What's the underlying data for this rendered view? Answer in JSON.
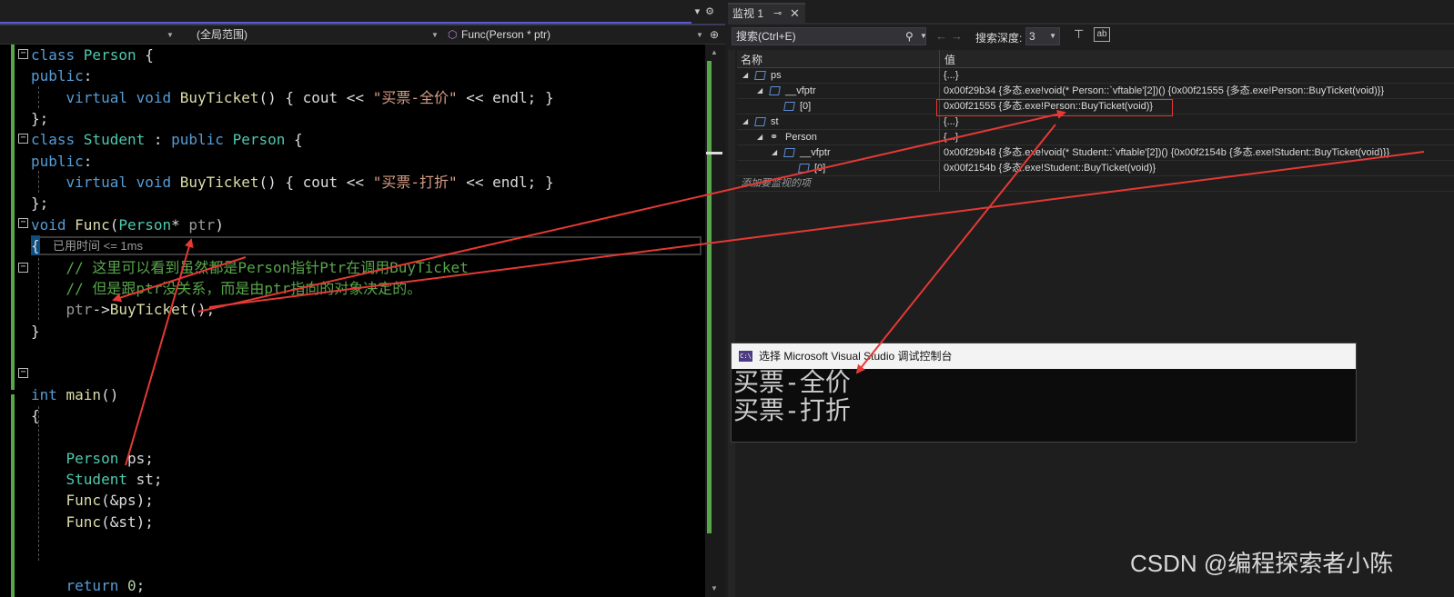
{
  "editor": {
    "nav": {
      "scope": "(全局范围)",
      "function": "Func(Person * ptr)"
    },
    "code_lines": [
      {
        "parts": [
          [
            "kw",
            "class "
          ],
          [
            "ty",
            "Person"
          ],
          [
            "pl",
            " {"
          ]
        ]
      },
      {
        "parts": [
          [
            "kw",
            "public"
          ],
          [
            "pl",
            ":"
          ]
        ]
      },
      {
        "parts": [
          [
            "pl",
            "    "
          ],
          [
            "kw",
            "virtual void "
          ],
          [
            "fn",
            "BuyTicket"
          ],
          [
            "pl",
            "() { cout << "
          ],
          [
            "str",
            "\"买票-全价\""
          ],
          [
            "pl",
            " << endl; }"
          ]
        ]
      },
      {
        "parts": [
          [
            "pl",
            "};"
          ]
        ]
      },
      {
        "parts": [
          [
            "kw",
            "class "
          ],
          [
            "ty",
            "Student"
          ],
          [
            "pl",
            " : "
          ],
          [
            "kw",
            "public "
          ],
          [
            "ty",
            "Person"
          ],
          [
            "pl",
            " {"
          ]
        ]
      },
      {
        "parts": [
          [
            "kw",
            "public"
          ],
          [
            "pl",
            ":"
          ]
        ]
      },
      {
        "parts": [
          [
            "pl",
            "    "
          ],
          [
            "kw",
            "virtual void "
          ],
          [
            "fn",
            "BuyTicket"
          ],
          [
            "pl",
            "() { cout << "
          ],
          [
            "str",
            "\"买票-打折\""
          ],
          [
            "pl",
            " << endl; }"
          ]
        ]
      },
      {
        "parts": [
          [
            "pl",
            "};"
          ]
        ]
      },
      {
        "parts": [
          [
            "kw",
            "void "
          ],
          [
            "fn",
            "Func"
          ],
          [
            "pl",
            "("
          ],
          [
            "ty",
            "Person"
          ],
          [
            "pl",
            "* "
          ],
          [
            "prm",
            "ptr"
          ],
          [
            "pl",
            ")"
          ]
        ]
      },
      {
        "parts": [
          [
            "pl",
            ""
          ]
        ]
      },
      {
        "parts": [
          [
            "pl",
            "    "
          ],
          [
            "cm",
            "// 这里可以看到虽然都是Person指针Ptr在调用BuyTicket"
          ]
        ]
      },
      {
        "parts": [
          [
            "pl",
            "    "
          ],
          [
            "cm",
            "// 但是跟ptr没关系，而是由ptr指向的对象决定的。"
          ]
        ]
      },
      {
        "parts": [
          [
            "pl",
            "    "
          ],
          [
            "prm",
            "ptr"
          ],
          [
            "pl",
            "->"
          ],
          [
            "fn",
            "BuyTicket"
          ],
          [
            "pl",
            "();"
          ]
        ]
      },
      {
        "parts": [
          [
            "pl",
            "}"
          ]
        ]
      },
      {
        "parts": [
          [
            "pl",
            ""
          ]
        ]
      },
      {
        "parts": [
          [
            "pl",
            ""
          ]
        ]
      },
      {
        "parts": [
          [
            "kw",
            "int "
          ],
          [
            "fn",
            "main"
          ],
          [
            "pl",
            "()"
          ]
        ]
      },
      {
        "parts": [
          [
            "pl",
            "{"
          ]
        ]
      },
      {
        "parts": [
          [
            "pl",
            ""
          ]
        ]
      },
      {
        "parts": [
          [
            "pl",
            "    "
          ],
          [
            "ty",
            "Person"
          ],
          [
            "pl",
            " ps;"
          ]
        ]
      },
      {
        "parts": [
          [
            "pl",
            "    "
          ],
          [
            "ty",
            "Student"
          ],
          [
            "pl",
            " st;"
          ]
        ]
      },
      {
        "parts": [
          [
            "pl",
            "    "
          ],
          [
            "fn",
            "Func"
          ],
          [
            "pl",
            "(&ps);"
          ]
        ]
      },
      {
        "parts": [
          [
            "pl",
            "    "
          ],
          [
            "fn",
            "Func"
          ],
          [
            "pl",
            "(&st);"
          ]
        ]
      },
      {
        "parts": [
          [
            "pl",
            ""
          ]
        ]
      },
      {
        "parts": [
          [
            "pl",
            ""
          ]
        ]
      },
      {
        "parts": [
          [
            "pl",
            "    "
          ],
          [
            "kw",
            "return "
          ],
          [
            "num",
            "0"
          ],
          [
            "pl",
            ";"
          ]
        ]
      },
      {
        "parts": [
          [
            "pl",
            "}"
          ]
        ]
      }
    ],
    "open_brace": "{",
    "elapsed": "已用时间 <= 1ms"
  },
  "watch": {
    "tab_title": "监视 1",
    "pin_glyph": "⊸",
    "close_glyph": "✕",
    "search_placeholder": "搜索(Ctrl+E)",
    "depth_label": "搜索深度:",
    "depth_value": "3",
    "columns": {
      "name": "名称",
      "value": "值"
    },
    "rows": [
      {
        "name": "ps",
        "value": "{...}"
      },
      {
        "name": "__vfptr",
        "value": "0x00f29b34 {多态.exe!void(* Person::`vftable'[2])() {0x00f21555 {多态.exe!Person::BuyTicket(void)}}"
      },
      {
        "name": "[0]",
        "value": "0x00f21555 {多态.exe!Person::BuyTicket(void)}"
      },
      {
        "name": "st",
        "value": "{...}"
      },
      {
        "name": "Person",
        "value": "{...}"
      },
      {
        "name": "__vfptr",
        "value": "0x00f29b48 {多态.exe!void(* Student::`vftable'[2])() {0x00f2154b {多态.exe!Student::BuyTicket(void)}}"
      },
      {
        "name": "[0]",
        "value": "0x00f2154b {多态.exe!Student::BuyTicket(void)}"
      }
    ],
    "add_row": "添加要监视的项"
  },
  "console": {
    "icon_text": "C:\\",
    "title": "选择 Microsoft Visual Studio 调试控制台",
    "lines": [
      "买票-全价",
      "买票-打折"
    ]
  },
  "watermark": "CSDN @编程探索者小陈",
  "colors": {
    "keyword": "#569cd6",
    "type": "#4ec9b0",
    "function": "#dcdcaa",
    "string": "#d69d85",
    "comment": "#57a64a",
    "annotation_arrow": "#e53935"
  }
}
